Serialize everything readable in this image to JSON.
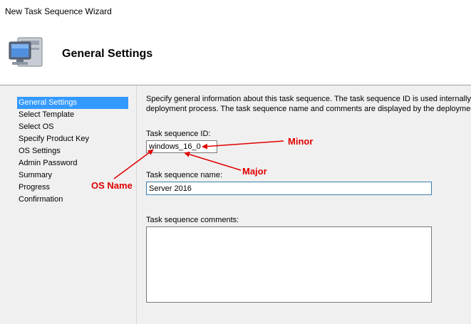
{
  "window": {
    "title": "New Task Sequence Wizard"
  },
  "banner": {
    "title": "General Settings",
    "icon": "computer-monitor-icon"
  },
  "sidebar": {
    "items": [
      {
        "label": "General Settings",
        "active": true
      },
      {
        "label": "Select Template"
      },
      {
        "label": "Select OS"
      },
      {
        "label": "Specify Product Key"
      },
      {
        "label": "OS Settings"
      },
      {
        "label": "Admin Password"
      },
      {
        "label": "Summary"
      },
      {
        "label": "Progress"
      },
      {
        "label": "Confirmation"
      }
    ]
  },
  "main": {
    "description_line1": "Specify general information about this task sequence.  The task sequence ID is used internally as",
    "description_line2": "deployment process.  The task sequence name and comments are displayed by the deployment w",
    "id_label": "Task sequence ID:",
    "id_value": "windows_16_0",
    "name_label": "Task sequence name:",
    "name_value": "Server 2016",
    "comments_label": "Task sequence comments:",
    "comments_value": ""
  },
  "annotations": {
    "minor": "Minor",
    "major": "Major",
    "os_name": "OS Name",
    "color": "#e00000"
  }
}
